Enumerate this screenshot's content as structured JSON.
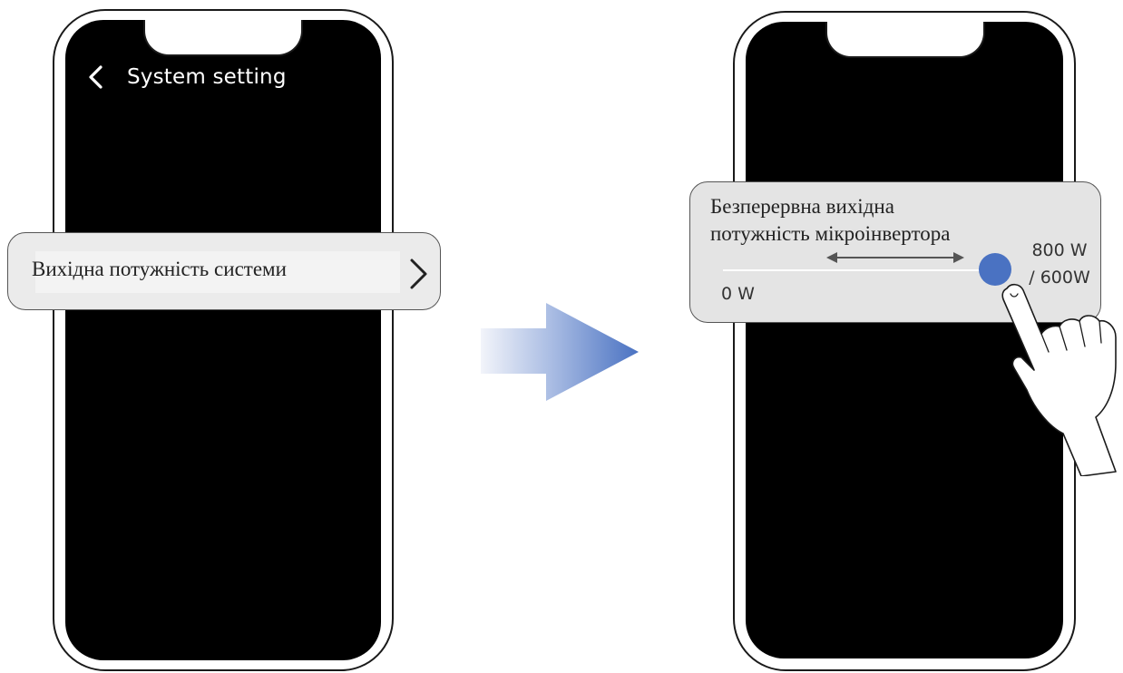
{
  "left_phone": {
    "header": {
      "back_icon": "chevron-left-icon",
      "title": "System setting"
    },
    "menu_item": {
      "label": "Вихідна потужність системи",
      "icon": "chevron-right-icon"
    }
  },
  "transition": {
    "icon": "gradient-right-arrow-icon",
    "colors": {
      "from": "#f2f4fa",
      "to": "#4a72c2"
    }
  },
  "right_phone": {
    "slider": {
      "title_line1": "Безперервна вихідна",
      "title_line2": "потужність мікроінвертора",
      "min_label": "0 W",
      "max_label_line1": "800 W",
      "max_label_line2": "/ 600W",
      "value_fraction": 1.0,
      "thumb_color": "#4a72c2",
      "drag_indicator_icon": "double-arrow-icon"
    },
    "gesture_icon": "tapping-hand-icon"
  },
  "colors": {
    "screen": "#000000",
    "card": "#e4e4e4",
    "accent": "#4a72c2"
  }
}
